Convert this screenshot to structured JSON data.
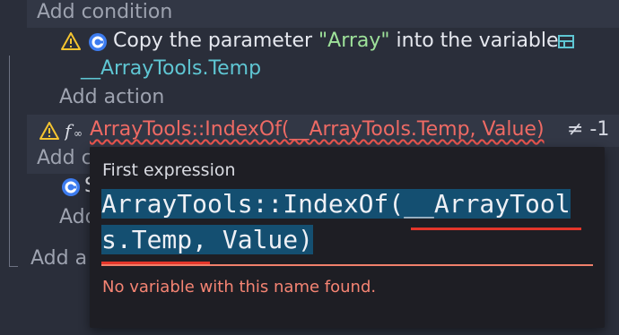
{
  "events": {
    "add_condition_top": "Add condition",
    "action_param_prefix": "Copy the parameter",
    "action_param_value": "\"Array\"",
    "action_param_suffix": "into the variable",
    "action_variable": "__ArrayTools.Temp",
    "add_action": "Add action",
    "condition_expression": "ArrayTools::IndexOf(__ArrayTools.Temp, Value)",
    "condition_operator": "≠ -1",
    "add_condition_partial": "Add c",
    "action_partial": "S",
    "add_action_partial": "Add",
    "add_partial_bottom": "Add a"
  },
  "tooltip": {
    "title": "First expression",
    "code_line_1": "ArrayTools::IndexOf(__ArrayTool",
    "code_line_2": "s.Temp, Value)",
    "error": "No variable with this name found."
  },
  "icons": {
    "warning": "warning-icon",
    "gdevelop": "gdevelop-icon",
    "variable": "variable-icon",
    "function": "function-icon"
  },
  "colors": {
    "background": "#2a2e3a",
    "error": "#ee6a64",
    "parameter": "#9ee29a",
    "variable": "#5fc6d3",
    "warning": "#f4c430",
    "tooltip_bg": "#1e1e24",
    "selection": "#144f71"
  }
}
